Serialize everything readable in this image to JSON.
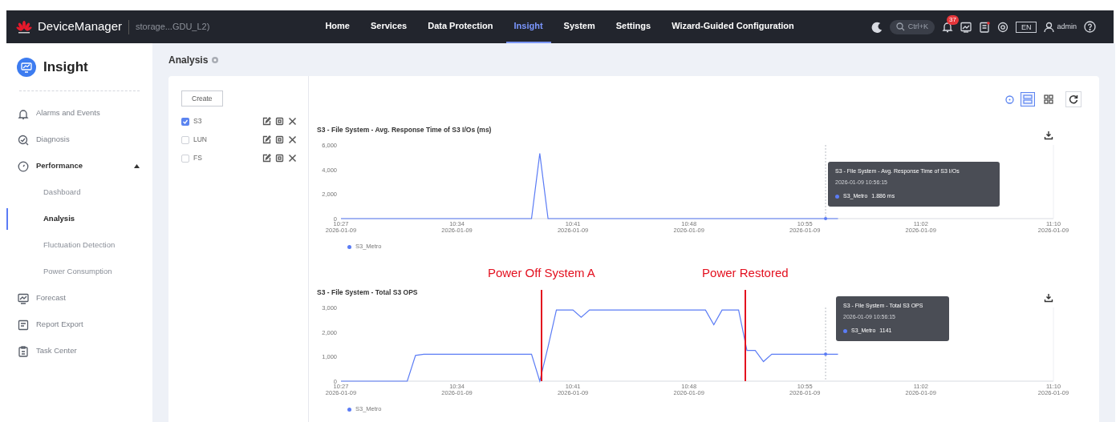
{
  "header": {
    "brand": "DeviceManager",
    "device": "storage...GDU_L2)",
    "nav": [
      {
        "label": "Home",
        "selected": false
      },
      {
        "label": "Services",
        "selected": false
      },
      {
        "label": "Data Protection",
        "selected": false
      },
      {
        "label": "Insight",
        "selected": true
      },
      {
        "label": "System",
        "selected": false
      },
      {
        "label": "Settings",
        "selected": false
      },
      {
        "label": "Wizard-Guided Configuration",
        "selected": false
      }
    ],
    "search_shortcut": "Ctrl+K",
    "notification_count": "37",
    "language": "EN",
    "user": "admin"
  },
  "sidebar": {
    "title": "Insight",
    "items": [
      {
        "label": "Alarms and Events",
        "selected": false
      },
      {
        "label": "Diagnosis",
        "selected": false
      },
      {
        "label": "Performance",
        "selected": false,
        "expanded": true,
        "children": [
          {
            "label": "Dashboard",
            "selected": false
          },
          {
            "label": "Analysis",
            "selected": true
          },
          {
            "label": "Fluctuation Detection",
            "selected": false
          },
          {
            "label": "Power Consumption",
            "selected": false
          }
        ]
      },
      {
        "label": "Forecast",
        "selected": false
      },
      {
        "label": "Report Export",
        "selected": false
      },
      {
        "label": "Task Center",
        "selected": false
      }
    ]
  },
  "page_title": "Analysis",
  "list": {
    "create_button": "Create",
    "items": [
      {
        "label": "S3",
        "checked": true
      },
      {
        "label": "LUN",
        "checked": false
      },
      {
        "label": "FS",
        "checked": false
      }
    ]
  },
  "view_options": [
    {
      "kind": "list",
      "selected": true
    },
    {
      "kind": "grid",
      "selected": false
    }
  ],
  "charts": [
    {
      "tooltip": {
        "title": "S3 - File System - Avg. Response Time of S3 I/Os",
        "time": "2026-01-09 10:56:15",
        "series": "S3_Metro",
        "value": "1.886 ms"
      },
      "chart_data": {
        "type": "line",
        "title": "S3 - File System - Avg. Response Time of S3 I/Os (ms)",
        "categories": [
          "10:27\n2026-01-09",
          null,
          null,
          null,
          null,
          null,
          null,
          null,
          null,
          null,
          null,
          null,
          null,
          null,
          "10:34\n2026-01-09",
          null,
          null,
          null,
          null,
          null,
          null,
          null,
          null,
          null,
          null,
          null,
          null,
          null,
          "10:41\n2026-01-09",
          null,
          null,
          null,
          null,
          null,
          null,
          null,
          null,
          null,
          null,
          null,
          null,
          null,
          "10:48\n2026-01-09",
          null,
          null,
          null,
          null,
          null,
          null,
          null,
          null,
          null,
          null,
          null,
          null,
          null,
          "10:55\n2026-01-09",
          null,
          null,
          null,
          null,
          null,
          null,
          null,
          null,
          null,
          null,
          null,
          null,
          null,
          "11:02\n2026-01-09",
          null,
          null,
          null,
          null,
          null,
          null,
          null,
          null,
          null,
          null,
          null,
          null,
          null,
          null,
          null,
          "11:10\n2026-01-09"
        ],
        "series": [
          {
            "name": "S3_Metro",
            "color": "#5b7cf5",
            "values": [
              0,
              0,
              0,
              0,
              0,
              0,
              0,
              0,
              0,
              0,
              0,
              0,
              0,
              0,
              0,
              0,
              0,
              0,
              0,
              0,
              0,
              0,
              0,
              0,
              5300,
              0,
              0,
              0,
              0,
              0,
              0,
              0,
              0,
              0,
              0,
              0,
              0,
              0,
              0,
              0,
              0,
              0,
              0,
              0,
              0,
              0,
              0,
              0,
              0,
              0,
              0,
              0,
              0,
              0,
              0,
              0,
              0,
              0,
              0,
              0,
              0,
              null,
              null,
              null,
              null,
              null,
              null,
              null,
              null,
              null,
              null,
              null,
              null,
              null,
              null,
              null,
              null,
              null,
              null,
              null,
              null,
              null,
              null,
              null,
              null,
              null,
              null
            ]
          }
        ],
        "ylim": [
          0,
          6000
        ],
        "yticks": [
          {
            "value": 0,
            "label": "0"
          },
          {
            "value": 2000,
            "label": "2,000"
          },
          {
            "value": 4000,
            "label": "4,000"
          },
          {
            "value": 6000,
            "label": "6,000"
          }
        ]
      }
    },
    {
      "tooltip": {
        "title": "S3 - File System - Total S3 OPS",
        "time": "2026-01-09 10:56:15",
        "series": "S3_Metro",
        "value": "1141"
      },
      "chart_data": {
        "type": "line",
        "title": "S3 - File System - Total S3 OPS",
        "categories": [
          "10:27\n2026-01-09",
          null,
          null,
          null,
          null,
          null,
          null,
          null,
          null,
          null,
          null,
          null,
          null,
          null,
          "10:34\n2026-01-09",
          null,
          null,
          null,
          null,
          null,
          null,
          null,
          null,
          null,
          null,
          null,
          null,
          null,
          "10:41\n2026-01-09",
          null,
          null,
          null,
          null,
          null,
          null,
          null,
          null,
          null,
          null,
          null,
          null,
          null,
          "10:48\n2026-01-09",
          null,
          null,
          null,
          null,
          null,
          null,
          null,
          null,
          null,
          null,
          null,
          null,
          null,
          "10:55\n2026-01-09",
          null,
          null,
          null,
          null,
          null,
          null,
          null,
          null,
          null,
          null,
          null,
          null,
          null,
          "11:02\n2026-01-09",
          null,
          null,
          null,
          null,
          null,
          null,
          null,
          null,
          null,
          null,
          null,
          null,
          null,
          null,
          null,
          "11:10\n2026-01-09"
        ],
        "series": [
          {
            "name": "S3_Metro",
            "color": "#5b7cf5",
            "values": [
              0,
              0,
              0,
              0,
              0,
              0,
              0,
              0,
              0,
              1050,
              1100,
              1100,
              1100,
              1100,
              1100,
              1100,
              1100,
              1100,
              1100,
              1100,
              1100,
              1100,
              1100,
              1100,
              0,
              1400,
              2900,
              2900,
              2900,
              2600,
              2900,
              2900,
              2900,
              2900,
              2900,
              2900,
              2900,
              2900,
              2900,
              2900,
              2900,
              2900,
              2900,
              2900,
              2900,
              2300,
              2900,
              2900,
              2900,
              1250,
              1250,
              800,
              1100,
              1100,
              1100,
              1100,
              1100,
              1100,
              1100,
              1100,
              1100,
              null,
              null,
              null,
              null,
              null,
              null,
              null,
              null,
              null,
              null,
              null,
              null,
              null,
              null,
              null,
              null,
              null,
              null,
              null,
              null,
              null,
              null,
              null,
              null,
              null,
              null
            ]
          }
        ],
        "ylim": [
          0,
          3000
        ],
        "yticks": [
          {
            "value": 0,
            "label": "0"
          },
          {
            "value": 1000,
            "label": "1,000"
          },
          {
            "value": 2000,
            "label": "2,000"
          },
          {
            "value": 3000,
            "label": "3,000"
          }
        ],
        "annotations": [
          "Power Off System A",
          "Power Restored"
        ]
      }
    }
  ]
}
